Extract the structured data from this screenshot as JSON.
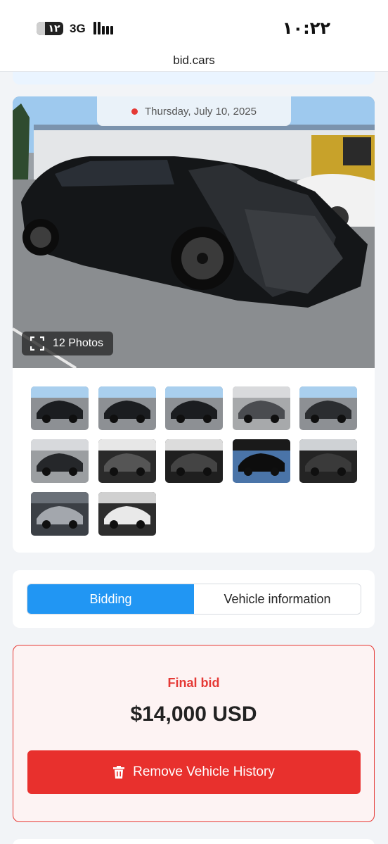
{
  "status_bar": {
    "battery_label": "١٢",
    "network": "3G",
    "time": "١٠:٢٢"
  },
  "browser": {
    "url": "bid.cars"
  },
  "gallery": {
    "date": "Thursday, July 10, 2025",
    "photos_button": "12 Photos",
    "thumbnail_count": 12
  },
  "tabs": [
    {
      "label": "Bidding",
      "active": true
    },
    {
      "label": "Vehicle information",
      "active": false
    }
  ],
  "bid": {
    "label": "Final bid",
    "value": "$14,000 USD",
    "button": "Remove Vehicle History"
  },
  "colors": {
    "accent_blue": "#2196f3",
    "danger_red": "#e53935"
  },
  "icons": {
    "date_dot": "red-dot-icon",
    "photos": "expand-icon",
    "remove": "trash-icon"
  }
}
